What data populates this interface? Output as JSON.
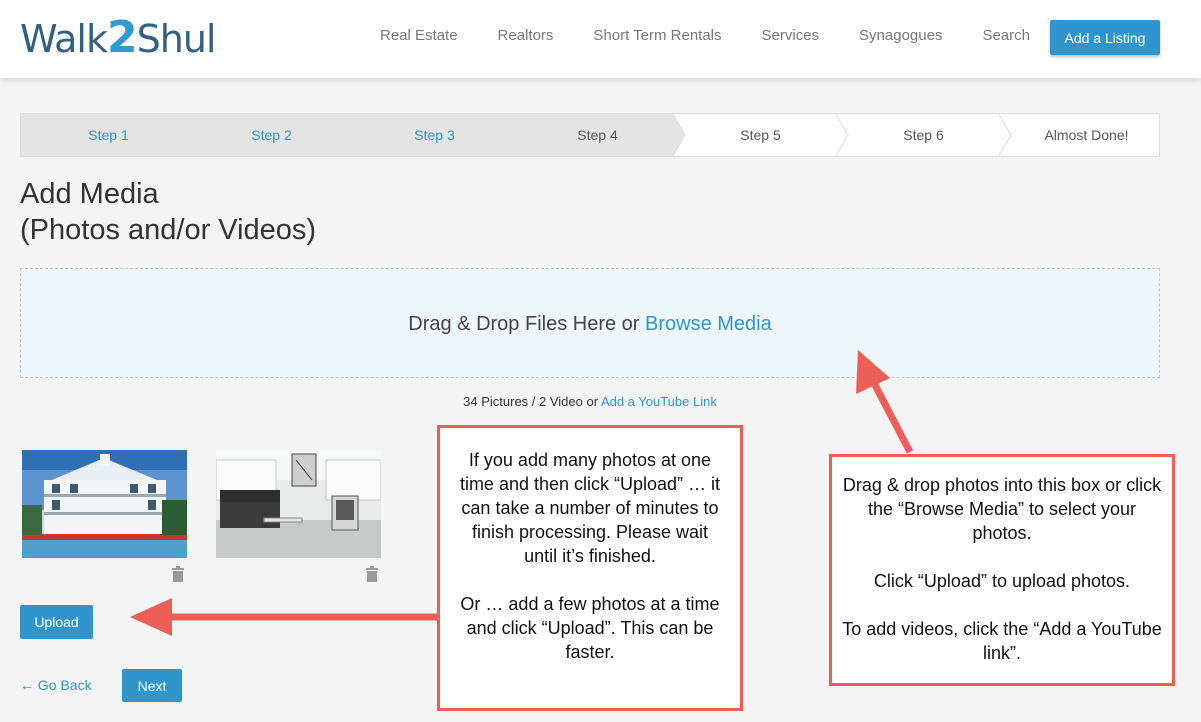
{
  "header": {
    "logo_pre": "Walk",
    "logo_two": "2",
    "logo_post": "Shul",
    "nav": [
      "Real Estate",
      "Realtors",
      "Short Term Rentals",
      "Services",
      "Synagogues",
      "Search"
    ],
    "cta": "Add a Listing"
  },
  "steps": [
    "Step 1",
    "Step 2",
    "Step 3",
    "Step 4",
    "Step 5",
    "Step 6",
    "Almost Done!"
  ],
  "page": {
    "title_line1": "Add Media",
    "title_line2": "(Photos and/or Videos)"
  },
  "dropzone": {
    "text": "Drag & Drop Files Here or ",
    "link": "Browse Media"
  },
  "counts": {
    "text": "34 Pictures / 2 Video or ",
    "link": "Add a YouTube Link"
  },
  "buttons": {
    "upload": "Upload",
    "go_back": "Go Back",
    "next": "Next"
  },
  "callouts": {
    "left": "If you add many photos at one time and then click “Upload” … it can take a number of minutes to finish processing. Please wait until it’s finished.\n\nOr … add a few photos at a time and click “Upload”. This can be faster.",
    "right": "Drag & drop photos into this box or click the “Browse Media” to select your photos.\n\nClick “Upload” to upload photos.\n\nTo add videos, click the “Add a YouTube link”."
  },
  "colors": {
    "accent": "#2f95cc",
    "callout_border": "#ec5f56",
    "logo_dark": "#33607e"
  }
}
